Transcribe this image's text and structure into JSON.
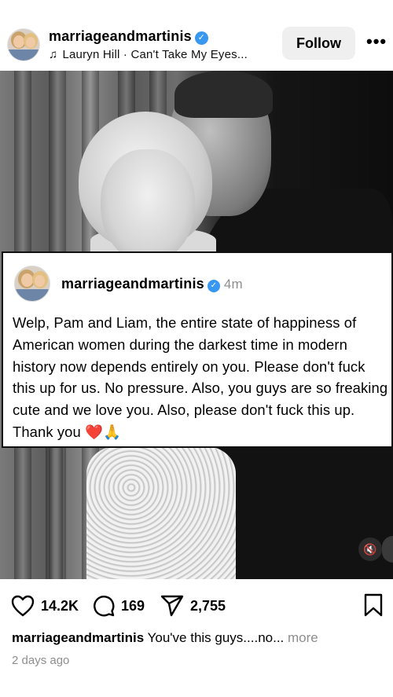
{
  "post": {
    "username": "marriageandmartinis",
    "verified_glyph": "✓",
    "song_icon": "music-note-icon",
    "song": "Lauryn Hill · Can't Take My Eyes...",
    "follow_label": "Follow",
    "more_label": "•••"
  },
  "overlay": {
    "username": "marriageandmartinis",
    "time": "4m",
    "text": "Welp, Pam and Liam, the entire state of happiness of American women during the darkest time in modern history now depends entirely on you. Please don't fuck this up for us. No pressure. Also, you guys are so freaking cute and we love you. Also, please don't fuck this up. Thank you ❤️🙏"
  },
  "actions": {
    "likes": "14.2K",
    "comments": "169",
    "shares": "2,755",
    "icons": [
      "heart-icon",
      "comment-icon",
      "share-icon",
      "bookmark-icon",
      "mute-icon"
    ]
  },
  "caption": {
    "username": "marriageandmartinis",
    "text": "You've this guys....no...",
    "more_label": "more"
  },
  "timestamp": "2 days ago",
  "colors": {
    "verified": "#3897f0",
    "muted_text": "#8e8e8e",
    "follow_bg": "#efefef"
  }
}
